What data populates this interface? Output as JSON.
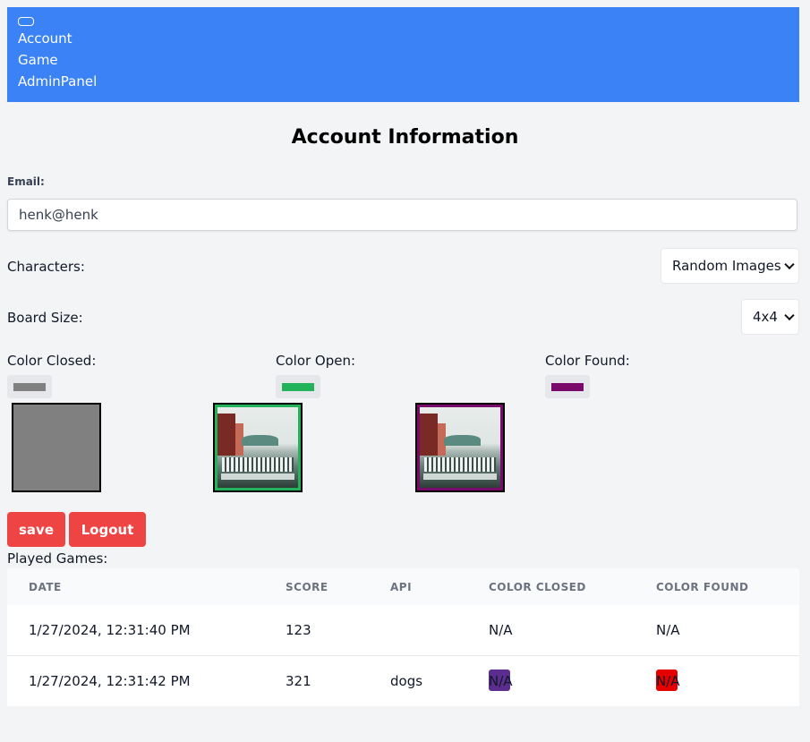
{
  "nav": {
    "links": [
      "Account",
      "Game",
      "AdminPanel"
    ],
    "color": "#3b82f6"
  },
  "page_title": "Account Information",
  "email": {
    "label": "Email:",
    "value": "henk@henk"
  },
  "characters": {
    "label": "Characters:",
    "selected": "Random Images"
  },
  "board_size": {
    "label": "Board Size:",
    "selected": "4x4"
  },
  "colors": {
    "closed": {
      "label": "Color Closed:",
      "value": "#808080"
    },
    "open": {
      "label": "Color Open:",
      "value": "#22b35a"
    },
    "found": {
      "label": "Color Found:",
      "value": "#7a0a6a"
    }
  },
  "buttons": {
    "save": "save",
    "logout": "Logout"
  },
  "played_games": {
    "title": "Played Games:",
    "columns": [
      "DATE",
      "SCORE",
      "API",
      "COLOR CLOSED",
      "COLOR FOUND"
    ],
    "rows": [
      {
        "date": "1/27/2024, 12:31:40 PM",
        "score": "123",
        "api": "",
        "color_closed": "N/A",
        "color_found": "N/A",
        "closed_color": null,
        "found_color": null
      },
      {
        "date": "1/27/2024, 12:31:42 PM",
        "score": "321",
        "api": "dogs",
        "color_closed": "N/A",
        "color_found": "N/A",
        "closed_color": "#5b2d8e",
        "found_color": "#e60000"
      }
    ]
  }
}
